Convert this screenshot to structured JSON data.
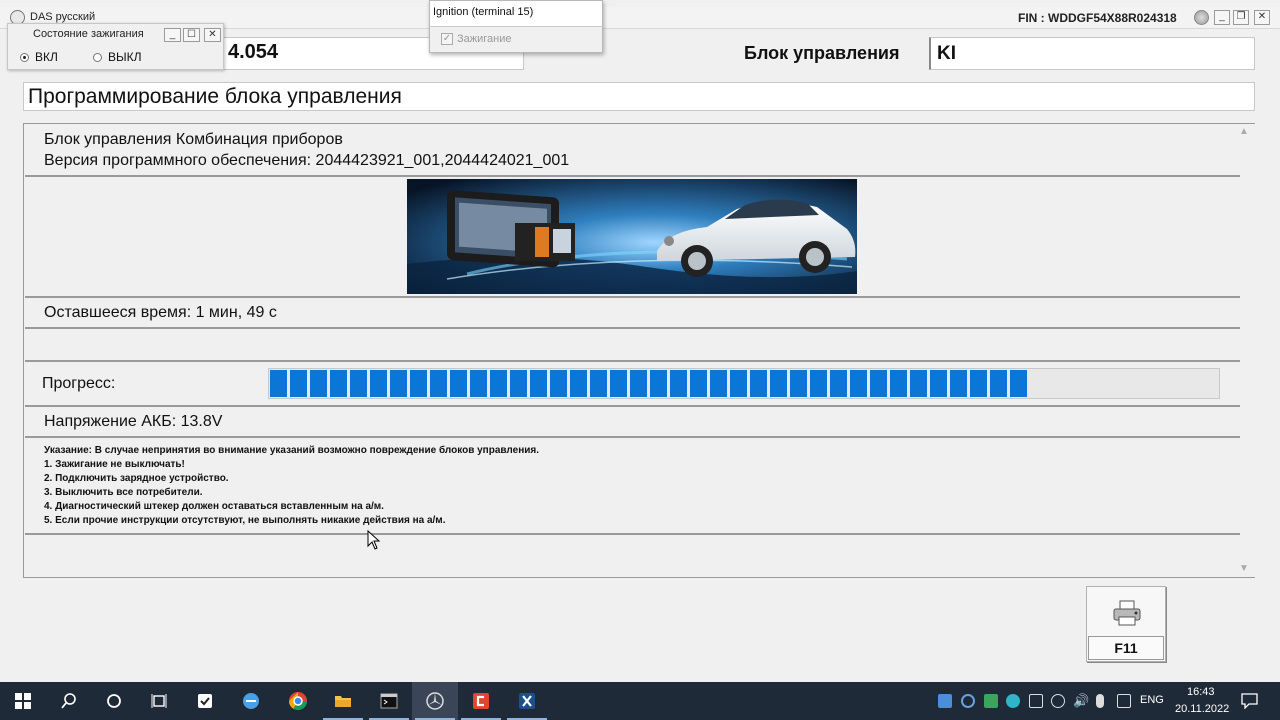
{
  "window": {
    "title": "DAS русский",
    "fin": "FIN : WDDGF54X88R024318"
  },
  "header": {
    "software_version": "4.054",
    "control_unit_label": "Блок управления",
    "control_unit_value": "KI"
  },
  "page_title": "Программирование блока управления",
  "ecu": {
    "unit_line": "Блок управления Комбинация приборов",
    "software_line": "Версия программного обеспечения: 2044423921_001,2044424021_001"
  },
  "remaining_time": "Оставшееся время: 1 мин, 49 с",
  "progress": {
    "label": "Прогресс:",
    "fraction": 0.8
  },
  "battery_voltage": "Напряжение АКБ: 13.8V",
  "notes": [
    "Указание:  В случае непринятия во внимание указаний возможно повреждение блоков управления.",
    "1. Зажигание не выключать!",
    "2. Подключить зарядное устройство.",
    "3. Выключить все потребители.",
    "4. Диагностический штекер должен оставаться вставленным на а/м.",
    "5. Если прочие инструкции отсутствуют, не выполнять никакие действия на а/м."
  ],
  "print_button": {
    "key": "F11",
    "icon": "printer-icon"
  },
  "ignition_window": {
    "title": "Состояние зажигания",
    "option_on": "ВКЛ",
    "option_off": "ВЫКЛ",
    "selected": "ВКЛ"
  },
  "terminal_popup": {
    "title": "Ignition (terminal 15)",
    "checkbox_label": "Зажигание",
    "checked": true
  },
  "taskbar": {
    "icons": [
      "windows-start-icon",
      "search-icon",
      "cortana-icon",
      "task-view-icon",
      "check-app-icon",
      "minus-app-icon",
      "chrome-icon",
      "file-explorer-icon",
      "terminal-icon",
      "mercedes-das-icon",
      "red-app-icon",
      "xentry-icon"
    ],
    "language": "ENG",
    "time": "16:43",
    "date": "20.11.2022"
  },
  "colors": {
    "progress": "#0c76d6",
    "taskbar": "#1f2a38"
  }
}
